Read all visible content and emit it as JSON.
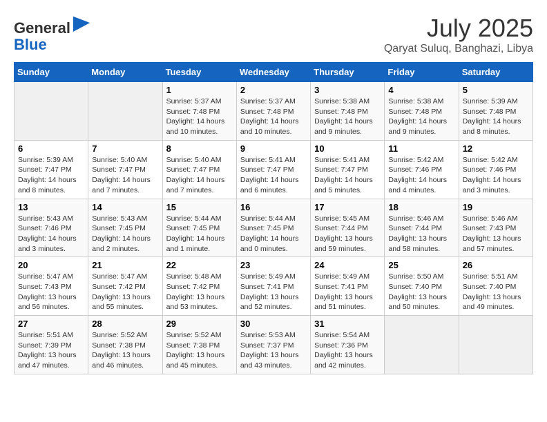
{
  "header": {
    "logo_line1": "General",
    "logo_line2": "Blue",
    "month_year": "July 2025",
    "location": "Qaryat Suluq, Banghazi, Libya"
  },
  "weekdays": [
    "Sunday",
    "Monday",
    "Tuesday",
    "Wednesday",
    "Thursday",
    "Friday",
    "Saturday"
  ],
  "weeks": [
    [
      {
        "day": "",
        "detail": ""
      },
      {
        "day": "",
        "detail": ""
      },
      {
        "day": "1",
        "detail": "Sunrise: 5:37 AM\nSunset: 7:48 PM\nDaylight: 14 hours\nand 10 minutes."
      },
      {
        "day": "2",
        "detail": "Sunrise: 5:37 AM\nSunset: 7:48 PM\nDaylight: 14 hours\nand 10 minutes."
      },
      {
        "day": "3",
        "detail": "Sunrise: 5:38 AM\nSunset: 7:48 PM\nDaylight: 14 hours\nand 9 minutes."
      },
      {
        "day": "4",
        "detail": "Sunrise: 5:38 AM\nSunset: 7:48 PM\nDaylight: 14 hours\nand 9 minutes."
      },
      {
        "day": "5",
        "detail": "Sunrise: 5:39 AM\nSunset: 7:48 PM\nDaylight: 14 hours\nand 8 minutes."
      }
    ],
    [
      {
        "day": "6",
        "detail": "Sunrise: 5:39 AM\nSunset: 7:47 PM\nDaylight: 14 hours\nand 8 minutes."
      },
      {
        "day": "7",
        "detail": "Sunrise: 5:40 AM\nSunset: 7:47 PM\nDaylight: 14 hours\nand 7 minutes."
      },
      {
        "day": "8",
        "detail": "Sunrise: 5:40 AM\nSunset: 7:47 PM\nDaylight: 14 hours\nand 7 minutes."
      },
      {
        "day": "9",
        "detail": "Sunrise: 5:41 AM\nSunset: 7:47 PM\nDaylight: 14 hours\nand 6 minutes."
      },
      {
        "day": "10",
        "detail": "Sunrise: 5:41 AM\nSunset: 7:47 PM\nDaylight: 14 hours\nand 5 minutes."
      },
      {
        "day": "11",
        "detail": "Sunrise: 5:42 AM\nSunset: 7:46 PM\nDaylight: 14 hours\nand 4 minutes."
      },
      {
        "day": "12",
        "detail": "Sunrise: 5:42 AM\nSunset: 7:46 PM\nDaylight: 14 hours\nand 3 minutes."
      }
    ],
    [
      {
        "day": "13",
        "detail": "Sunrise: 5:43 AM\nSunset: 7:46 PM\nDaylight: 14 hours\nand 3 minutes."
      },
      {
        "day": "14",
        "detail": "Sunrise: 5:43 AM\nSunset: 7:45 PM\nDaylight: 14 hours\nand 2 minutes."
      },
      {
        "day": "15",
        "detail": "Sunrise: 5:44 AM\nSunset: 7:45 PM\nDaylight: 14 hours\nand 1 minute."
      },
      {
        "day": "16",
        "detail": "Sunrise: 5:44 AM\nSunset: 7:45 PM\nDaylight: 14 hours\nand 0 minutes."
      },
      {
        "day": "17",
        "detail": "Sunrise: 5:45 AM\nSunset: 7:44 PM\nDaylight: 13 hours\nand 59 minutes."
      },
      {
        "day": "18",
        "detail": "Sunrise: 5:46 AM\nSunset: 7:44 PM\nDaylight: 13 hours\nand 58 minutes."
      },
      {
        "day": "19",
        "detail": "Sunrise: 5:46 AM\nSunset: 7:43 PM\nDaylight: 13 hours\nand 57 minutes."
      }
    ],
    [
      {
        "day": "20",
        "detail": "Sunrise: 5:47 AM\nSunset: 7:43 PM\nDaylight: 13 hours\nand 56 minutes."
      },
      {
        "day": "21",
        "detail": "Sunrise: 5:47 AM\nSunset: 7:42 PM\nDaylight: 13 hours\nand 55 minutes."
      },
      {
        "day": "22",
        "detail": "Sunrise: 5:48 AM\nSunset: 7:42 PM\nDaylight: 13 hours\nand 53 minutes."
      },
      {
        "day": "23",
        "detail": "Sunrise: 5:49 AM\nSunset: 7:41 PM\nDaylight: 13 hours\nand 52 minutes."
      },
      {
        "day": "24",
        "detail": "Sunrise: 5:49 AM\nSunset: 7:41 PM\nDaylight: 13 hours\nand 51 minutes."
      },
      {
        "day": "25",
        "detail": "Sunrise: 5:50 AM\nSunset: 7:40 PM\nDaylight: 13 hours\nand 50 minutes."
      },
      {
        "day": "26",
        "detail": "Sunrise: 5:51 AM\nSunset: 7:40 PM\nDaylight: 13 hours\nand 49 minutes."
      }
    ],
    [
      {
        "day": "27",
        "detail": "Sunrise: 5:51 AM\nSunset: 7:39 PM\nDaylight: 13 hours\nand 47 minutes."
      },
      {
        "day": "28",
        "detail": "Sunrise: 5:52 AM\nSunset: 7:38 PM\nDaylight: 13 hours\nand 46 minutes."
      },
      {
        "day": "29",
        "detail": "Sunrise: 5:52 AM\nSunset: 7:38 PM\nDaylight: 13 hours\nand 45 minutes."
      },
      {
        "day": "30",
        "detail": "Sunrise: 5:53 AM\nSunset: 7:37 PM\nDaylight: 13 hours\nand 43 minutes."
      },
      {
        "day": "31",
        "detail": "Sunrise: 5:54 AM\nSunset: 7:36 PM\nDaylight: 13 hours\nand 42 minutes."
      },
      {
        "day": "",
        "detail": ""
      },
      {
        "day": "",
        "detail": ""
      }
    ]
  ]
}
